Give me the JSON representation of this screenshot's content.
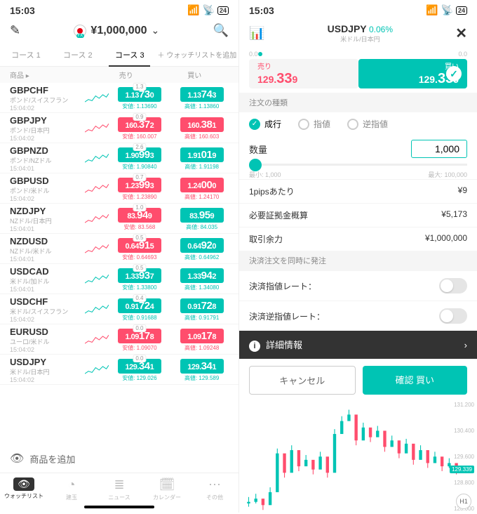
{
  "status": {
    "time": "15:03",
    "battery": "24"
  },
  "left": {
    "balance": "¥1,000,000",
    "tabs": [
      "コース 1",
      "コース 2",
      "コース 3"
    ],
    "active_tab": 2,
    "add_watchlist": "＋ ウォッチリストを追加",
    "columns": {
      "name": "商品 ▸",
      "sell": "売り",
      "buy": "買い"
    },
    "add_product": "商品を追加",
    "nav": [
      "ウォッチリスト",
      "建玉",
      "ニュース",
      "カレンダー",
      "その他"
    ],
    "instruments": [
      {
        "sym": "GBPCHF",
        "desc": "ポンド/スイスフラン",
        "time": "15:04:02",
        "spread": "1.3",
        "dir": "up",
        "sell": "1.13730",
        "buy": "1.13743",
        "low_lbl": "安値:",
        "low": "1.13690",
        "high_lbl": "高値:",
        "high": "1.13860"
      },
      {
        "sym": "GBPJPY",
        "desc": "ポンド/日本円",
        "time": "15:04:02",
        "spread": "0.9",
        "dir": "down",
        "sell": "160.372",
        "buy": "160.381",
        "low_lbl": "安値:",
        "low": "160.007",
        "high_lbl": "高値:",
        "high": "160.603"
      },
      {
        "sym": "GBPNZD",
        "desc": "ポンド/NZドル",
        "time": "15:04:01",
        "spread": "2.6",
        "dir": "up",
        "sell": "1.90993",
        "buy": "1.91019",
        "low_lbl": "安値:",
        "low": "1.90840",
        "high_lbl": "高値:",
        "high": "1.91198"
      },
      {
        "sym": "GBPUSD",
        "desc": "ポンド/米ドル",
        "time": "15:04:02",
        "spread": "0.7",
        "dir": "down",
        "sell": "1.23993",
        "buy": "1.24000",
        "low_lbl": "安値:",
        "low": "1.23890",
        "high_lbl": "高値:",
        "high": "1.24170"
      },
      {
        "sym": "NZDJPY",
        "desc": "NZドル/日本円",
        "time": "15:04:01",
        "spread": "1.0",
        "dir": "mixed",
        "sell": "83.949",
        "buy": "83.959",
        "low_lbl": "安値:",
        "low": "83.568",
        "high_lbl": "高値:",
        "high": "84.035"
      },
      {
        "sym": "NZDUSD",
        "desc": "NZドル/米ドル",
        "time": "15:04:01",
        "spread": "0.5",
        "dir": "mixed2",
        "sell": "0.64915",
        "buy": "0.64920",
        "low_lbl": "安値:",
        "low": "0.64693",
        "high_lbl": "高値:",
        "high": "0.64962"
      },
      {
        "sym": "USDCAD",
        "desc": "米ドル/加ドル",
        "time": "15:04:01",
        "spread": "0.5",
        "dir": "up",
        "sell": "1.33937",
        "buy": "1.33942",
        "low_lbl": "安値:",
        "low": "1.33800",
        "high_lbl": "高値:",
        "high": "1.34080"
      },
      {
        "sym": "USDCHF",
        "desc": "米ドル/スイスフラン",
        "time": "15:04:02",
        "spread": "0.4",
        "dir": "up",
        "sell": "0.91724",
        "buy": "0.91728",
        "low_lbl": "安値:",
        "low": "0.91688",
        "high_lbl": "高値:",
        "high": "0.91791"
      },
      {
        "sym": "EURUSD",
        "desc": "ユーロ/米ドル",
        "time": "15:04:02",
        "spread": "0.0",
        "dir": "down",
        "sell": "1.09178",
        "buy": "1.09178",
        "low_lbl": "安値:",
        "low": "1.09070",
        "high_lbl": "高値:",
        "high": "1.09248"
      },
      {
        "sym": "USDJPY",
        "desc": "米ドル/日本円",
        "time": "15:04:02",
        "spread": "0.0",
        "dir": "up",
        "sell": "129.341",
        "buy": "129.341",
        "low_lbl": "安値:",
        "low": "129.026",
        "high_lbl": "高値:",
        "high": "129.589"
      }
    ]
  },
  "right": {
    "pair": "USDJPY",
    "change": "0.06%",
    "pair_desc": "米ドル/日本円",
    "scale_min": "0.0",
    "scale_max": "0.0",
    "sell_label": "売り",
    "buy_label": "買い",
    "sell_price_main": "129.",
    "sell_price_big": "33",
    "sell_price_small": "9",
    "buy_price_main": "129.",
    "buy_price_big": "33",
    "buy_price_small": "9",
    "order_type_header": "注文の種類",
    "order_types": [
      "成行",
      "指値",
      "逆指値"
    ],
    "order_type_active": 0,
    "qty_label": "数量",
    "qty_value": "1,000",
    "qty_min_lbl": "最小:",
    "qty_min": "1,000",
    "qty_max_lbl": "最大:",
    "qty_max": "100,000",
    "pip_label": "1pipsあたり",
    "pip_value": "¥9",
    "margin_label": "必要証拠金概算",
    "margin_value": "¥5,173",
    "power_label": "取引余力",
    "power_value": "¥1,000,000",
    "closeout_header": "決済注文を同時に発注",
    "tp_label": "決済指値レート：",
    "sl_label": "決済逆指値レート：",
    "detail_label": "詳細情報",
    "cancel": "キャンセル",
    "confirm": "確認 買い",
    "chart_y": [
      "131.200",
      "130.400",
      "129.600",
      "128.800",
      "128.000"
    ],
    "chart_live": "129.339",
    "timeframe": "H1"
  },
  "chart_data": {
    "type": "line",
    "title": "USDJPY",
    "ylim": [
      128.0,
      131.4
    ],
    "x": [
      0,
      1,
      2,
      3,
      4,
      5,
      6,
      7,
      8,
      9,
      10,
      11,
      12,
      13,
      14,
      15,
      16,
      17,
      18,
      19,
      20,
      21,
      22,
      23,
      24,
      25,
      26,
      27,
      28,
      29
    ],
    "values": [
      128.3,
      128.4,
      128.2,
      128.6,
      129.8,
      129.2,
      129.9,
      129.4,
      129.6,
      129.3,
      129.7,
      129.2,
      130.4,
      130.8,
      131.0,
      130.2,
      130.6,
      130.3,
      130.5,
      130.0,
      130.2,
      129.8,
      130.1,
      129.6,
      129.9,
      129.5,
      129.7,
      129.4,
      129.5,
      129.3
    ]
  }
}
